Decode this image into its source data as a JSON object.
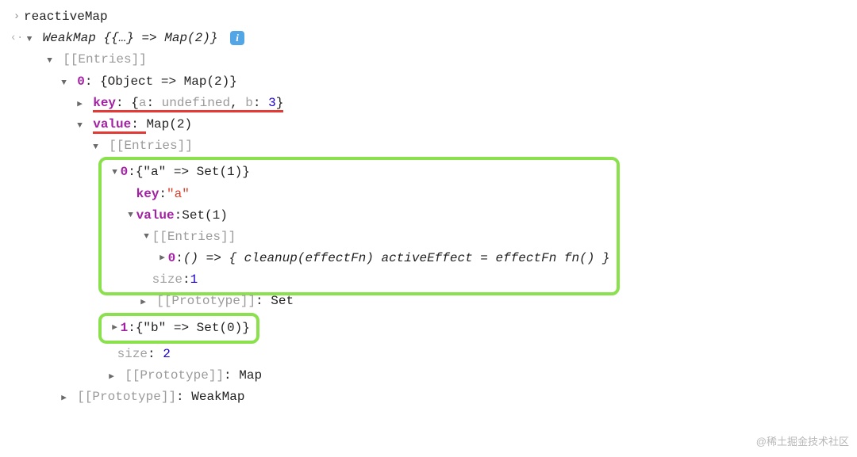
{
  "input": {
    "expr": "reactiveMap"
  },
  "output": {
    "summary_type": "WeakMap",
    "summary_preview": "{{…} => Map(2)}",
    "info_tooltip": "i",
    "entries_label": "[[Entries]]",
    "prototype_label": "[[Prototype]]",
    "root_proto_value": "WeakMap",
    "entry0": {
      "index": "0",
      "preview": "{Object => Map(2)}",
      "key_label": "key",
      "key_preview_open": "{",
      "key_a_name": "a",
      "key_a_sep": ": ",
      "key_a_val": "undefined",
      "key_comma": ", ",
      "key_b_name": "b",
      "key_b_sep": ": ",
      "key_b_val": "3",
      "key_preview_close": "}",
      "value_label": "value",
      "value_preview": "Map(2)",
      "inner_entries_label": "[[Entries]]",
      "inner0": {
        "index": "0",
        "preview": "{\"a\" => Set(1)}",
        "key_label": "key",
        "key_val": "\"a\"",
        "value_label": "value",
        "value_preview": "Set(1)",
        "set_entries_label": "[[Entries]]",
        "set_item_index": "0",
        "set_item_preview": "() => { cleanup(effectFn) activeEffect = effectFn fn() }",
        "size_label": "size",
        "size_val": "1",
        "proto_label": "[[Prototype]]",
        "proto_val": "Set"
      },
      "inner1": {
        "index": "1",
        "preview": "{\"b\" => Set(0)}"
      },
      "map_size_label": "size",
      "map_size_val": "2",
      "map_proto_label": "[[Prototype]]",
      "map_proto_val": "Map"
    }
  },
  "watermark": "@稀土掘金技术社区"
}
